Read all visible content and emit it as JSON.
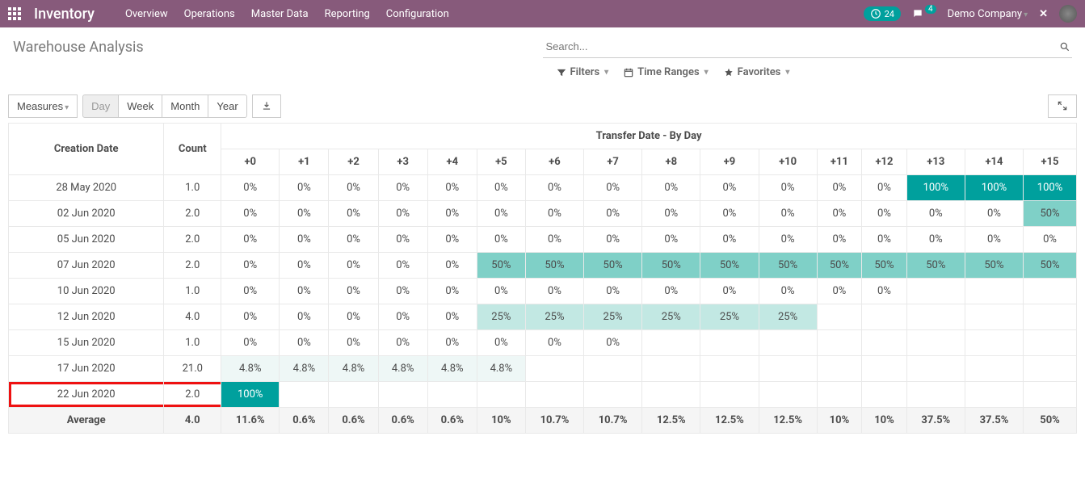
{
  "navbar": {
    "brand": "Inventory",
    "menu": [
      "Overview",
      "Operations",
      "Master Data",
      "Reporting",
      "Configuration"
    ],
    "clock_badge": "24",
    "msg_badge": "4",
    "company": "Demo Company",
    "close": "✕"
  },
  "page": {
    "title": "Warehouse Analysis",
    "search_placeholder": "Search...",
    "filters": "Filters",
    "time_ranges": "Time Ranges",
    "favorites": "Favorites"
  },
  "toolbar": {
    "measures": "Measures",
    "day": "Day",
    "week": "Week",
    "month": "Month",
    "year": "Year"
  },
  "table": {
    "creation_date_header": "Creation Date",
    "count_header": "Count",
    "super_header": "Transfer Date - By Day",
    "columns": [
      "+0",
      "+1",
      "+2",
      "+3",
      "+4",
      "+5",
      "+6",
      "+7",
      "+8",
      "+9",
      "+10",
      "+11",
      "+12",
      "+13",
      "+14",
      "+15"
    ],
    "rows": [
      {
        "date": "28 May 2020",
        "count": "1.0",
        "cells": [
          {
            "v": "0%"
          },
          {
            "v": "0%"
          },
          {
            "v": "0%"
          },
          {
            "v": "0%"
          },
          {
            "v": "0%"
          },
          {
            "v": "0%"
          },
          {
            "v": "0%"
          },
          {
            "v": "0%"
          },
          {
            "v": "0%"
          },
          {
            "v": "0%"
          },
          {
            "v": "0%"
          },
          {
            "v": "0%"
          },
          {
            "v": "0%"
          },
          {
            "v": "100%",
            "c": "#00A09D",
            "fg": "#fff"
          },
          {
            "v": "100%",
            "c": "#00A09D",
            "fg": "#fff"
          },
          {
            "v": "100%",
            "c": "#00A09D",
            "fg": "#fff"
          }
        ]
      },
      {
        "date": "02 Jun 2020",
        "count": "2.0",
        "cells": [
          {
            "v": "0%"
          },
          {
            "v": "0%"
          },
          {
            "v": "0%"
          },
          {
            "v": "0%"
          },
          {
            "v": "0%"
          },
          {
            "v": "0%"
          },
          {
            "v": "0%"
          },
          {
            "v": "0%"
          },
          {
            "v": "0%"
          },
          {
            "v": "0%"
          },
          {
            "v": "0%"
          },
          {
            "v": "0%"
          },
          {
            "v": "0%"
          },
          {
            "v": "0%"
          },
          {
            "v": "0%"
          },
          {
            "v": "50%",
            "c": "#7FD0C7"
          }
        ]
      },
      {
        "date": "05 Jun 2020",
        "count": "2.0",
        "cells": [
          {
            "v": "0%"
          },
          {
            "v": "0%"
          },
          {
            "v": "0%"
          },
          {
            "v": "0%"
          },
          {
            "v": "0%"
          },
          {
            "v": "0%"
          },
          {
            "v": "0%"
          },
          {
            "v": "0%"
          },
          {
            "v": "0%"
          },
          {
            "v": "0%"
          },
          {
            "v": "0%"
          },
          {
            "v": "0%"
          },
          {
            "v": "0%"
          },
          {
            "v": "0%"
          },
          {
            "v": "0%"
          },
          {
            "v": "0%"
          }
        ]
      },
      {
        "date": "07 Jun 2020",
        "count": "2.0",
        "cells": [
          {
            "v": "0%"
          },
          {
            "v": "0%"
          },
          {
            "v": "0%"
          },
          {
            "v": "0%"
          },
          {
            "v": "0%"
          },
          {
            "v": "50%",
            "c": "#7FD0C7"
          },
          {
            "v": "50%",
            "c": "#7FD0C7"
          },
          {
            "v": "50%",
            "c": "#7FD0C7"
          },
          {
            "v": "50%",
            "c": "#7FD0C7"
          },
          {
            "v": "50%",
            "c": "#7FD0C7"
          },
          {
            "v": "50%",
            "c": "#7FD0C7"
          },
          {
            "v": "50%",
            "c": "#7FD0C7"
          },
          {
            "v": "50%",
            "c": "#7FD0C7"
          },
          {
            "v": "50%",
            "c": "#7FD0C7"
          },
          {
            "v": "50%",
            "c": "#7FD0C7"
          },
          {
            "v": "50%",
            "c": "#7FD0C7"
          }
        ]
      },
      {
        "date": "10 Jun 2020",
        "count": "1.0",
        "cells": [
          {
            "v": "0%"
          },
          {
            "v": "0%"
          },
          {
            "v": "0%"
          },
          {
            "v": "0%"
          },
          {
            "v": "0%"
          },
          {
            "v": "0%"
          },
          {
            "v": "0%"
          },
          {
            "v": "0%"
          },
          {
            "v": "0%"
          },
          {
            "v": "0%"
          },
          {
            "v": "0%"
          },
          {
            "v": "0%"
          },
          {
            "v": "0%"
          }
        ]
      },
      {
        "date": "12 Jun 2020",
        "count": "4.0",
        "cells": [
          {
            "v": "0%"
          },
          {
            "v": "0%"
          },
          {
            "v": "0%"
          },
          {
            "v": "0%"
          },
          {
            "v": "0%"
          },
          {
            "v": "25%",
            "c": "#C2E8E3"
          },
          {
            "v": "25%",
            "c": "#C2E8E3"
          },
          {
            "v": "25%",
            "c": "#C2E8E3"
          },
          {
            "v": "25%",
            "c": "#C2E8E3"
          },
          {
            "v": "25%",
            "c": "#C2E8E3"
          },
          {
            "v": "25%",
            "c": "#C2E8E3"
          }
        ]
      },
      {
        "date": "15 Jun 2020",
        "count": "1.0",
        "cells": [
          {
            "v": "0%"
          },
          {
            "v": "0%"
          },
          {
            "v": "0%"
          },
          {
            "v": "0%"
          },
          {
            "v": "0%"
          },
          {
            "v": "0%"
          },
          {
            "v": "0%"
          },
          {
            "v": "0%"
          }
        ]
      },
      {
        "date": "17 Jun 2020",
        "count": "21.0",
        "cells": [
          {
            "v": "4.8%",
            "c": "#EEF7F6"
          },
          {
            "v": "4.8%",
            "c": "#EEF7F6"
          },
          {
            "v": "4.8%",
            "c": "#EEF7F6"
          },
          {
            "v": "4.8%",
            "c": "#EEF7F6"
          },
          {
            "v": "4.8%",
            "c": "#EEF7F6"
          },
          {
            "v": "4.8%",
            "c": "#EEF7F6"
          }
        ]
      },
      {
        "date": "22 Jun 2020",
        "count": "2.0",
        "highlight": true,
        "cells": [
          {
            "v": "100%",
            "c": "#00A09D",
            "fg": "#fff"
          }
        ]
      }
    ],
    "average_label": "Average",
    "average": {
      "count": "4.0",
      "cells": [
        {
          "v": "11.6%"
        },
        {
          "v": "0.6%"
        },
        {
          "v": "0.6%"
        },
        {
          "v": "0.6%"
        },
        {
          "v": "0.6%"
        },
        {
          "v": "10%"
        },
        {
          "v": "10.7%"
        },
        {
          "v": "10.7%"
        },
        {
          "v": "12.5%"
        },
        {
          "v": "12.5%"
        },
        {
          "v": "12.5%"
        },
        {
          "v": "10%"
        },
        {
          "v": "10%"
        },
        {
          "v": "37.5%"
        },
        {
          "v": "37.5%"
        },
        {
          "v": "50%"
        }
      ]
    }
  },
  "chart_data": {
    "type": "table",
    "title": "Warehouse Analysis — Transfer Date - By Day (cohort %)",
    "row_labels": [
      "28 May 2020",
      "02 Jun 2020",
      "05 Jun 2020",
      "07 Jun 2020",
      "10 Jun 2020",
      "12 Jun 2020",
      "15 Jun 2020",
      "17 Jun 2020",
      "22 Jun 2020"
    ],
    "counts": [
      1.0,
      2.0,
      2.0,
      2.0,
      1.0,
      4.0,
      1.0,
      21.0,
      2.0
    ],
    "columns": [
      "+0",
      "+1",
      "+2",
      "+3",
      "+4",
      "+5",
      "+6",
      "+7",
      "+8",
      "+9",
      "+10",
      "+11",
      "+12",
      "+13",
      "+14",
      "+15"
    ],
    "matrix_percent": [
      [
        0,
        0,
        0,
        0,
        0,
        0,
        0,
        0,
        0,
        0,
        0,
        0,
        0,
        100,
        100,
        100
      ],
      [
        0,
        0,
        0,
        0,
        0,
        0,
        0,
        0,
        0,
        0,
        0,
        0,
        0,
        0,
        0,
        50
      ],
      [
        0,
        0,
        0,
        0,
        0,
        0,
        0,
        0,
        0,
        0,
        0,
        0,
        0,
        0,
        0,
        0
      ],
      [
        0,
        0,
        0,
        0,
        0,
        50,
        50,
        50,
        50,
        50,
        50,
        50,
        50,
        50,
        50,
        50
      ],
      [
        0,
        0,
        0,
        0,
        0,
        0,
        0,
        0,
        0,
        0,
        0,
        0,
        0,
        null,
        null,
        null
      ],
      [
        0,
        0,
        0,
        0,
        0,
        25,
        25,
        25,
        25,
        25,
        25,
        null,
        null,
        null,
        null,
        null
      ],
      [
        0,
        0,
        0,
        0,
        0,
        0,
        0,
        0,
        null,
        null,
        null,
        null,
        null,
        null,
        null,
        null
      ],
      [
        4.8,
        4.8,
        4.8,
        4.8,
        4.8,
        4.8,
        null,
        null,
        null,
        null,
        null,
        null,
        null,
        null,
        null,
        null
      ],
      [
        100,
        null,
        null,
        null,
        null,
        null,
        null,
        null,
        null,
        null,
        null,
        null,
        null,
        null,
        null,
        null
      ]
    ],
    "average_percent": [
      11.6,
      0.6,
      0.6,
      0.6,
      0.6,
      10,
      10.7,
      10.7,
      12.5,
      12.5,
      12.5,
      10,
      10,
      37.5,
      37.5,
      50
    ],
    "average_count": 4.0
  }
}
